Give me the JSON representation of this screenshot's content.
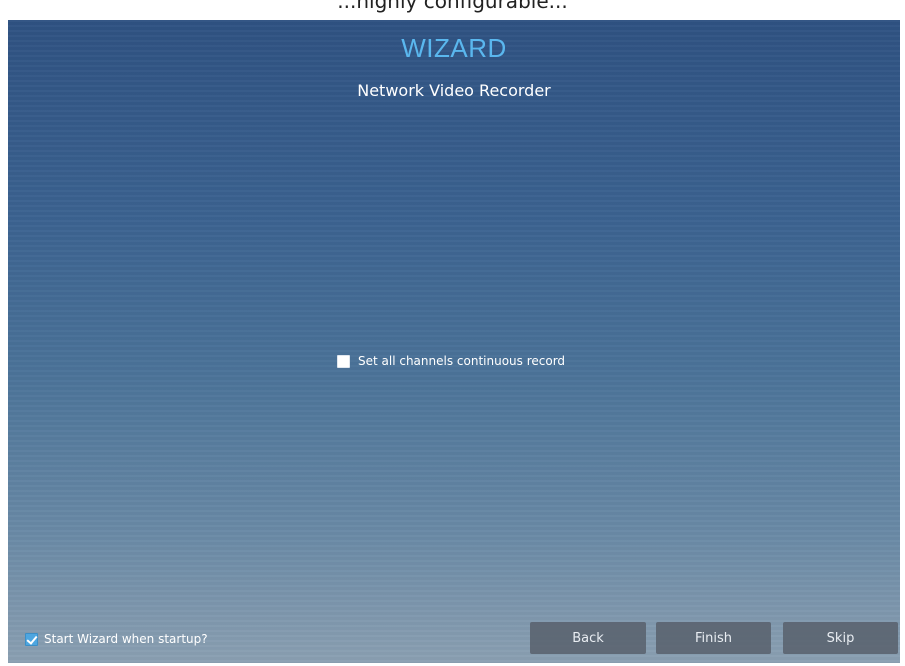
{
  "caption": "...highly configurable...",
  "wizard": {
    "title": "WIZARD",
    "subtitle": "Network Video Recorder"
  },
  "record_option": {
    "label": "Set all channels continuous record",
    "checked": false
  },
  "startup_option": {
    "label": "Start Wizard when startup?",
    "checked": true
  },
  "buttons": {
    "back": "Back",
    "finish": "Finish",
    "skip": "Skip"
  },
  "colors": {
    "title_accent": "#5ab7ee",
    "checkbox_checked": "#4ea6e0",
    "button_bg": "#58606c"
  }
}
